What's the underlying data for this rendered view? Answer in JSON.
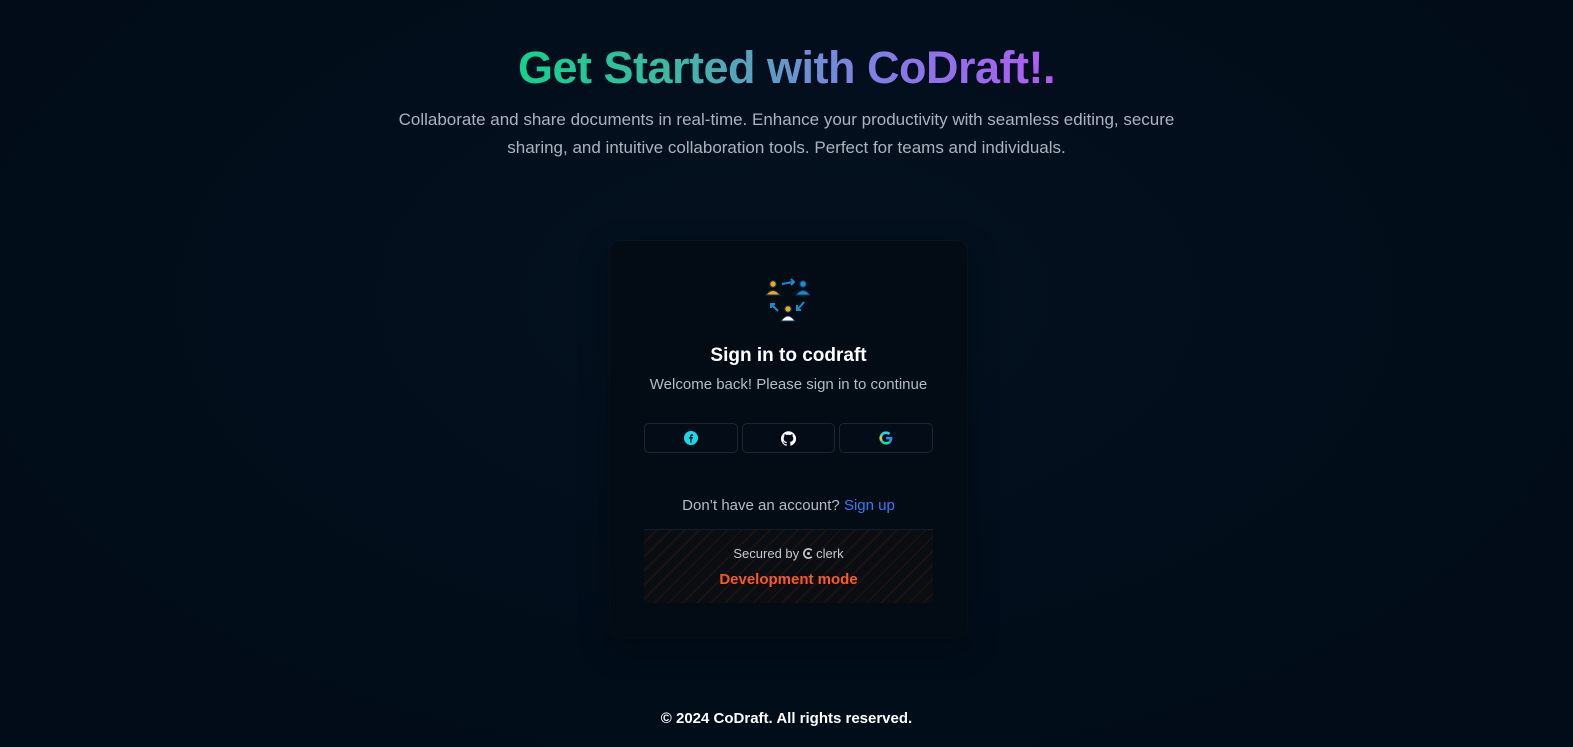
{
  "hero": {
    "title": "Get Started with CoDraft!.",
    "subtitle": "Collaborate and share documents in real-time. Enhance your productivity with seamless editing, secure sharing, and intuitive collaboration tools. Perfect for teams and individuals."
  },
  "signin_card": {
    "logo_icon": "collaboration-people-icon",
    "title": "Sign in to codraft",
    "subtitle": "Welcome back! Please sign in to continue",
    "social_providers": [
      {
        "name": "facebook",
        "icon": "facebook-icon"
      },
      {
        "name": "github",
        "icon": "github-icon"
      },
      {
        "name": "google",
        "icon": "google-icon"
      }
    ],
    "signup_prompt": "Don’t have an account?",
    "signup_link": "Sign up",
    "secured_by": "Secured by",
    "clerk_brand": "clerk",
    "dev_mode": "Development mode"
  },
  "footer": {
    "copyright": "© 2024 CoDraft. All rights reserved."
  },
  "colors": {
    "background": "#020d1a",
    "card": "#030b15",
    "link": "#2f7df6",
    "dev_mode": "#ff5a1f",
    "gradient_start": "#10d38d",
    "gradient_end": "#b05cf0"
  }
}
